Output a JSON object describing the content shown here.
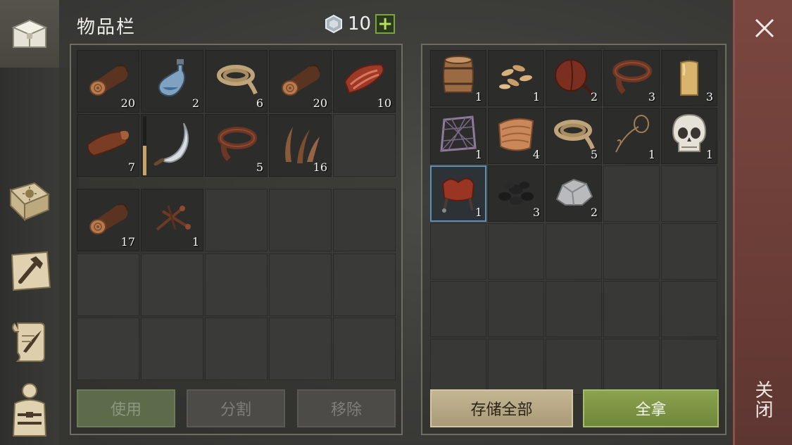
{
  "inventory": {
    "title": "物品栏",
    "currency": {
      "icon": "silver-gem-icon",
      "amount": "10",
      "add_icon": "plus-icon"
    },
    "main_slots": [
      {
        "icon": "log-icon",
        "qty": "20"
      },
      {
        "icon": "water-flask-icon",
        "qty": "2"
      },
      {
        "icon": "rope-coil-icon",
        "qty": "6"
      },
      {
        "icon": "log-icon",
        "qty": "20"
      },
      {
        "icon": "raw-meat-icon",
        "qty": "10"
      },
      {
        "icon": "leather-hide-icon",
        "qty": "7"
      },
      {
        "icon": "sickle-icon",
        "qty": "",
        "durability": 0.5
      },
      {
        "icon": "leather-strip-icon",
        "qty": "5"
      },
      {
        "icon": "plant-fiber-icon",
        "qty": "16"
      },
      {
        "icon": "",
        "qty": ""
      }
    ],
    "pocket_slots": [
      {
        "icon": "log-icon",
        "qty": "17"
      },
      {
        "icon": "nails-icon",
        "qty": "1"
      },
      {
        "icon": "",
        "qty": ""
      },
      {
        "icon": "",
        "qty": ""
      },
      {
        "icon": "",
        "qty": ""
      }
    ],
    "buttons": {
      "use": "使用",
      "split": "分割",
      "remove": "移除"
    }
  },
  "container": {
    "slots": [
      {
        "icon": "barrel-icon",
        "qty": "1"
      },
      {
        "icon": "seeds-icon",
        "qty": "1"
      },
      {
        "icon": "leather-bag-icon",
        "qty": "2"
      },
      {
        "icon": "leather-strip-icon",
        "qty": "3"
      },
      {
        "icon": "candle-icon",
        "qty": "3"
      },
      {
        "icon": "fishing-net-icon",
        "qty": "1"
      },
      {
        "icon": "cloth-icon",
        "qty": "4"
      },
      {
        "icon": "rope-coil-icon",
        "qty": "5"
      },
      {
        "icon": "lasso-icon",
        "qty": "1"
      },
      {
        "icon": "skull-icon",
        "qty": "1"
      },
      {
        "icon": "saddle-icon",
        "qty": "1"
      },
      {
        "icon": "coal-icon",
        "qty": "3"
      },
      {
        "icon": "iron-ore-icon",
        "qty": "2"
      }
    ],
    "buttons": {
      "store_all": "存储全部",
      "take_all": "全拿"
    }
  },
  "sidebar": {
    "tabs": [
      {
        "name": "chest-icon",
        "active": true
      },
      {
        "name": "sun-book-icon",
        "active": false
      },
      {
        "name": "crafting-hammer-icon",
        "active": false
      },
      {
        "name": "scroll-quill-icon",
        "active": false
      },
      {
        "name": "character-armor-icon",
        "active": false
      }
    ]
  },
  "close": {
    "icon": "close-icon",
    "label": "关闭"
  },
  "colors": {
    "accent_green": "#8ba24f",
    "close_panel": "#6b3d37",
    "tan_button": "#c4b593"
  }
}
